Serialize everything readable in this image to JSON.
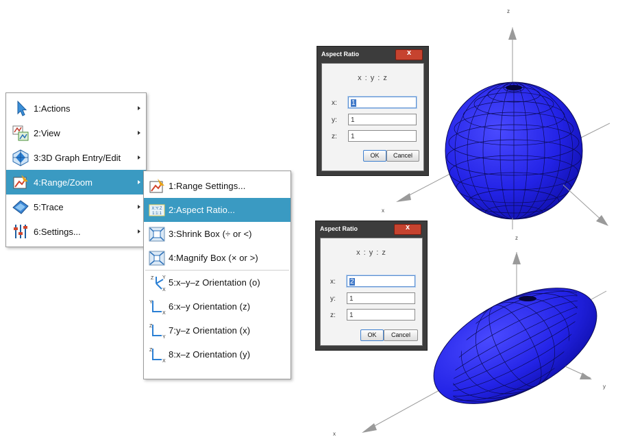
{
  "menu": {
    "items": [
      {
        "label": "1:Actions",
        "icon": "cursor-arrow-icon"
      },
      {
        "label": "2:View",
        "icon": "view-icon"
      },
      {
        "label": "3:3D Graph Entry/Edit",
        "icon": "3d-graph-icon"
      },
      {
        "label": "4:Range/Zoom",
        "icon": "range-zoom-icon"
      },
      {
        "label": "5:Trace",
        "icon": "trace-icon"
      },
      {
        "label": "6:Settings...",
        "icon": "sliders-icon"
      }
    ],
    "selected_index": 3
  },
  "submenu": {
    "items": [
      {
        "label": "1:Range Settings...",
        "icon": "range-settings-icon"
      },
      {
        "label": "2:Aspect Ratio...",
        "icon": "aspect-ratio-icon"
      },
      {
        "label": "3:Shrink Box (÷ or <)",
        "icon": "shrink-box-icon"
      },
      {
        "label": "4:Magnify Box (× or >)",
        "icon": "magnify-box-icon"
      },
      {
        "label": "5:x–y–z Orientation (o)",
        "icon": "xyz-orientation-icon"
      },
      {
        "label": "6:x–y Orientation (z)",
        "icon": "xy-orientation-icon"
      },
      {
        "label": "7:y–z Orientation (x)",
        "icon": "yz-orientation-icon"
      },
      {
        "label": "8:x–z Orientation (y)",
        "icon": "xz-orientation-icon"
      }
    ],
    "selected_index": 1
  },
  "dialog1": {
    "title": "Aspect Ratio",
    "ratio_label": "x : y : z",
    "x_label": "x:",
    "x_value": "1",
    "y_label": "y:",
    "y_value": "1",
    "z_label": "z:",
    "z_value": "1",
    "ok": "OK",
    "cancel": "Cancel"
  },
  "dialog2": {
    "title": "Aspect Ratio",
    "ratio_label": "x : y : z",
    "x_label": "x:",
    "x_value": "2",
    "y_label": "y:",
    "y_value": "1",
    "z_label": "z:",
    "z_value": "1",
    "ok": "OK",
    "cancel": "Cancel"
  },
  "axes": {
    "top": {
      "z": "z",
      "x": "x"
    },
    "bottom": {
      "z": "z",
      "x": "x",
      "y": "y"
    }
  },
  "colors": {
    "menu_highlight": "#3a9ac2",
    "surface_fill": "#2222ee",
    "surface_mesh": "#0a0a55"
  }
}
